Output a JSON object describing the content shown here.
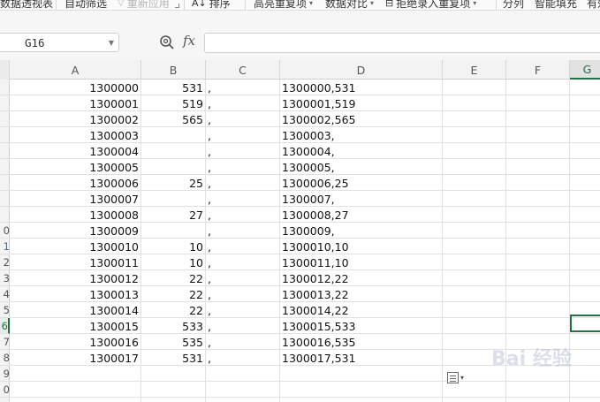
{
  "ribbon": {
    "items": [
      {
        "label": "数据透视表",
        "disabled": false
      },
      {
        "label": "自动筛选",
        "disabled": false
      },
      {
        "label": "重新应用",
        "disabled": true
      },
      {
        "label": "排序",
        "disabled": false
      },
      {
        "label": "高亮重复项",
        "disabled": false
      },
      {
        "label": "数据对比",
        "disabled": false
      },
      {
        "label": "拒绝录入重复项",
        "disabled": false
      },
      {
        "label": "分列",
        "disabled": false
      },
      {
        "label": "智能填充",
        "disabled": false
      },
      {
        "label": "有效",
        "disabled": false
      }
    ]
  },
  "formula_bar": {
    "cell_ref": "G16",
    "fx_label": "fx",
    "formula": ""
  },
  "columns": [
    "A",
    "B",
    "C",
    "D",
    "E",
    "F",
    "G"
  ],
  "active_column": "G",
  "row_labels": [
    "",
    "",
    "",
    "",
    "",
    "",
    "",
    "",
    "",
    "0",
    "1",
    "2",
    "3",
    "4",
    "5",
    "6",
    "7",
    "8",
    "9",
    "0"
  ],
  "active_row_index": 15,
  "rows": [
    {
      "a": "1300000",
      "b": "531",
      "c": ",",
      "d": "1300000,531"
    },
    {
      "a": "1300001",
      "b": "519",
      "c": ",",
      "d": "1300001,519"
    },
    {
      "a": "1300002",
      "b": "565",
      "c": ",",
      "d": "1300002,565"
    },
    {
      "a": "1300003",
      "b": "",
      "c": ",",
      "d": "1300003,"
    },
    {
      "a": "1300004",
      "b": "",
      "c": ",",
      "d": "1300004,"
    },
    {
      "a": "1300005",
      "b": "",
      "c": ",",
      "d": "1300005,"
    },
    {
      "a": "1300006",
      "b": "25",
      "c": ",",
      "d": "1300006,25"
    },
    {
      "a": "1300007",
      "b": "",
      "c": ",",
      "d": "1300007,"
    },
    {
      "a": "1300008",
      "b": "27",
      "c": ",",
      "d": "1300008,27"
    },
    {
      "a": "1300009",
      "b": "",
      "c": ",",
      "d": "1300009,"
    },
    {
      "a": "1300010",
      "b": "10",
      "c": ",",
      "d": "1300010,10"
    },
    {
      "a": "1300011",
      "b": "10",
      "c": ",",
      "d": "1300011,10"
    },
    {
      "a": "1300012",
      "b": "22",
      "c": ",",
      "d": "1300012,22"
    },
    {
      "a": "1300013",
      "b": "22",
      "c": ",",
      "d": "1300013,22"
    },
    {
      "a": "1300014",
      "b": "22",
      "c": ",",
      "d": "1300014,22"
    },
    {
      "a": "1300015",
      "b": "533",
      "c": ",",
      "d": "1300015,533"
    },
    {
      "a": "1300016",
      "b": "535",
      "c": ",",
      "d": "1300016,535"
    },
    {
      "a": "1300017",
      "b": "531",
      "c": ",",
      "d": "1300017,531"
    }
  ],
  "watermark": {
    "text": "Bai 经验"
  },
  "colors": {
    "accent": "#217346",
    "grid": "#e1e1e1",
    "header_bg": "#f3f3f3"
  }
}
